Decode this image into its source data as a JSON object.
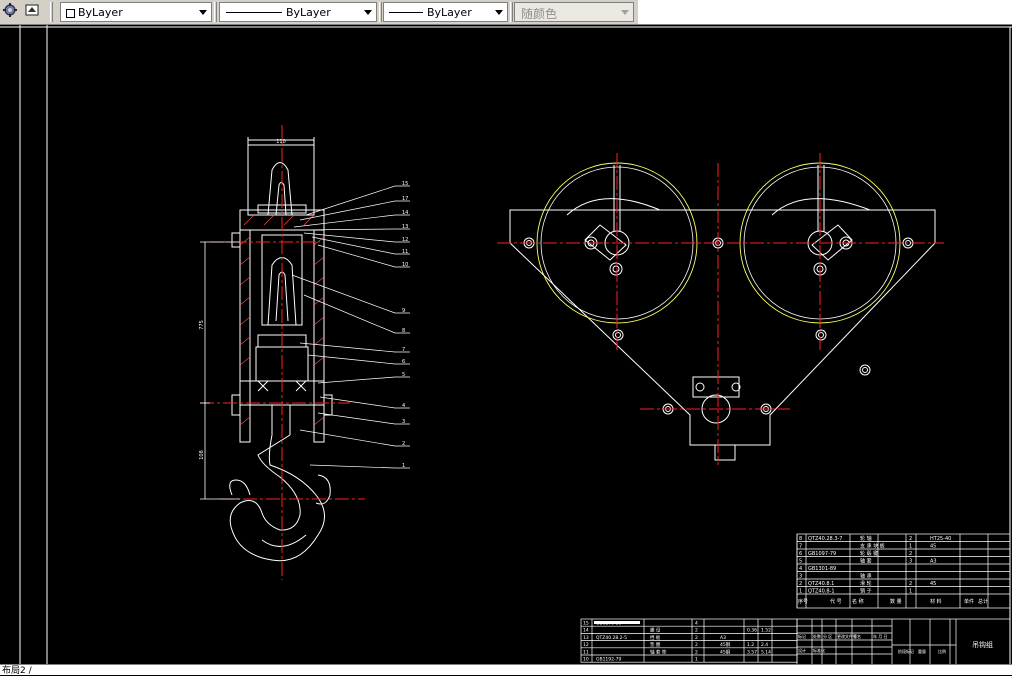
{
  "toolbar": {
    "color_combo": {
      "value": "ByLayer",
      "icon": "color-swatch"
    },
    "linetype_combo": {
      "value": "ByLayer"
    },
    "lineweight_combo": {
      "value": "ByLayer"
    },
    "plotstyle_combo": {
      "value": "随颜色"
    }
  },
  "drawing": {
    "left_dims": {
      "top_width": "110",
      "height1": "775",
      "height2": "108"
    },
    "hook_callouts": [
      "15",
      "17",
      "14",
      "13",
      "12",
      "11",
      "10",
      "9",
      "8",
      "7",
      "6",
      "5",
      "4",
      "3",
      "2",
      "1"
    ],
    "bom_upper": {
      "rows": [
        {
          "no": "8",
          "code": "QTZ40.28.3-7",
          "name": "轮 轴",
          "qty": "2",
          "mat": "HT25-40"
        },
        {
          "no": "7",
          "code": "",
          "name": "支 承 块 板",
          "qty": "1",
          "mat": "45"
        },
        {
          "no": "6",
          "code": "GB1097-79",
          "name": "轮 毂 键",
          "qty": "2",
          "mat": ""
        },
        {
          "no": "5",
          "code": "",
          "name": "轴 套",
          "qty": "3",
          "mat": "A3"
        },
        {
          "no": "4",
          "code": "GB1301-89",
          "name": "",
          "qty": "",
          "mat": ""
        },
        {
          "no": "3",
          "code": "",
          "name": "轴 承",
          "qty": "",
          "mat": ""
        },
        {
          "no": "2",
          "code": "QTZ40.8.1",
          "name": "滑 轮",
          "qty": "2",
          "mat": "45"
        },
        {
          "no": "1",
          "code": "QTZ40.8-1",
          "name": "销 子",
          "qty": "1",
          "mat": ""
        }
      ],
      "footer": [
        "序号",
        "代 号",
        "名 称",
        "数 量",
        "材 料",
        "单件",
        "总计"
      ]
    },
    "bom_lower": {
      "rows": [
        {
          "no": "15",
          "code": "GB6170-86",
          "name": "",
          "qty": "4"
        },
        {
          "no": "14",
          "code": "",
          "name": "螺 母",
          "qty": "2",
          "v1": "0.36",
          "v2": "1.52"
        },
        {
          "no": "13",
          "code": "QTZ40.28.2-5",
          "name": "挡 板",
          "qty": "2",
          "mat": "A3",
          "v1": "",
          "v2": ""
        },
        {
          "no": "12",
          "code": "",
          "name": "垫 圈",
          "qty": "2",
          "mat": "45钢",
          "v1": "1.2",
          "v2": "2.4"
        },
        {
          "no": "11",
          "code": "",
          "name": "轴 套 垫",
          "qty": "2",
          "mat": "45钢",
          "v1": "3.57",
          "v2": "5.14"
        },
        {
          "no": "10",
          "code": "GB1192-79",
          "name": "",
          "qty": "1",
          "mat": ""
        }
      ]
    },
    "title_block": {
      "title": "吊钩组",
      "cells": [
        "标记",
        "处数",
        "分 区",
        "更改文件号",
        "签名",
        "年 月 日",
        "设计",
        "标准化",
        "阶段标记",
        "重量",
        "比例"
      ]
    }
  },
  "command_line": {
    "text": "布局2 /"
  }
}
